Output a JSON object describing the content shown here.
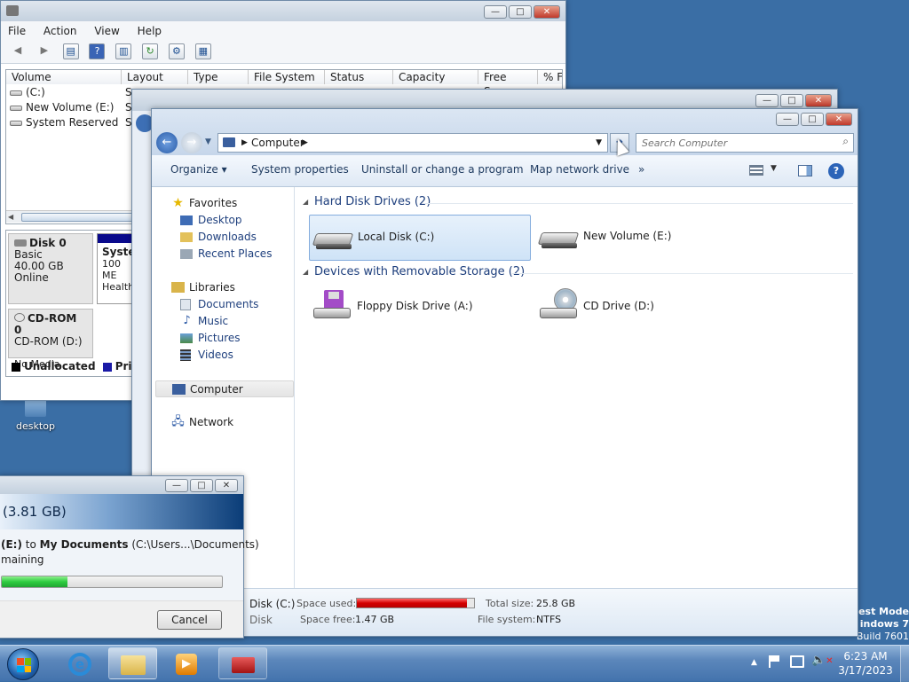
{
  "desktop": {
    "icon_label": "desktop",
    "watermark": [
      "est Mode",
      "indows 7",
      "Build 7601"
    ]
  },
  "disk_mgmt": {
    "menu": [
      "File",
      "Action",
      "View",
      "Help"
    ],
    "columns": [
      "Volume",
      "Layout",
      "Type",
      "File System",
      "Status",
      "Capacity",
      "Free Space",
      "% Fr"
    ],
    "volumes": [
      {
        "name": "(C:)",
        "layout": "S"
      },
      {
        "name": "New Volume (E:)",
        "layout": "S"
      },
      {
        "name": "System Reserved",
        "layout": "S"
      }
    ],
    "disk0": {
      "name": "Disk 0",
      "type": "Basic",
      "size": "40.00 GB",
      "status": "Online",
      "part_name": "Syste",
      "part_size": "100 ME",
      "part_status": "Healthy"
    },
    "cdrom": {
      "name": "CD-ROM 0",
      "type": "CD-ROM (D:)",
      "status": "No Media"
    },
    "legend": [
      "Unallocated",
      "Prima"
    ]
  },
  "explorer": {
    "address_segments": [
      "Computer"
    ],
    "search_placeholder": "Search Computer",
    "commands": [
      "Organize",
      "System properties",
      "Uninstall or change a program",
      "Map network drive",
      "»"
    ],
    "nav": {
      "favorites": "Favorites",
      "fav_items": [
        "Desktop",
        "Downloads",
        "Recent Places"
      ],
      "libraries": "Libraries",
      "lib_items": [
        "Documents",
        "Music",
        "Pictures",
        "Videos"
      ],
      "computer": "Computer",
      "network": "Network"
    },
    "groups": [
      {
        "title": "Hard Disk Drives (2)",
        "items": [
          "Local Disk (C:)",
          "New Volume (E:)"
        ]
      },
      {
        "title": "Devices with Removable Storage (2)",
        "items": [
          "Floppy Disk Drive (A:)",
          "CD Drive (D:)"
        ]
      }
    ],
    "details": {
      "name_line1": "Disk  (C:)",
      "name_line2": "Disk",
      "space_used_label": "Space used:",
      "space_free_label": "Space free:",
      "space_free": "1.47 GB",
      "total_label": "Total size:",
      "total": "25.8 GB",
      "fs_label": "File system:",
      "fs": "NTFS",
      "used_fraction": 0.94
    }
  },
  "copy_dialog": {
    "size_text": "(3.81 GB)",
    "line_from": "(E:)",
    "line_to_word": "to",
    "line_dest": "My Documents",
    "line_path": "(C:\\Users...\\Documents)",
    "remaining": "maining",
    "progress": 0.3,
    "cancel": "Cancel"
  },
  "taskbar": {
    "time": "6:23 AM",
    "date": "3/17/2023"
  },
  "colors": {
    "desktop": "#3a6ea5",
    "accent": "#1e3f7d",
    "progress_green": "#2ecc40",
    "disk_red": "#d40000"
  }
}
